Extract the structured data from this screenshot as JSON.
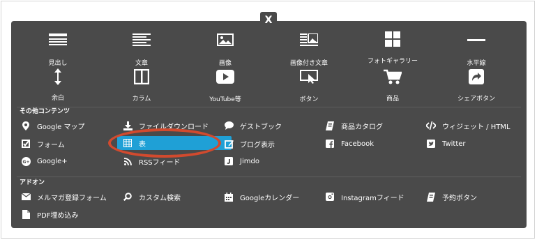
{
  "close": {
    "label": "X"
  },
  "tiles_row1": [
    {
      "label": "見出し",
      "icon": "heading-icon"
    },
    {
      "label": "文章",
      "icon": "text-icon"
    },
    {
      "label": "画像",
      "icon": "image-icon"
    },
    {
      "label": "画像付き文章",
      "icon": "image-text-icon"
    },
    {
      "label": "フォトギャラリー",
      "icon": "gallery-icon"
    },
    {
      "label": "水平線",
      "icon": "horizontal-line-icon"
    }
  ],
  "tiles_row2": [
    {
      "label": "余白",
      "icon": "spacing-icon"
    },
    {
      "label": "カラム",
      "icon": "column-icon"
    },
    {
      "label": "YouTube等",
      "icon": "video-icon"
    },
    {
      "label": "ボタン",
      "icon": "button-icon"
    },
    {
      "label": "商品",
      "icon": "cart-icon"
    },
    {
      "label": "シェアボタン",
      "icon": "share-icon"
    }
  ],
  "other": {
    "title": "その他コンテンツ",
    "items": [
      {
        "label": "Google マップ",
        "icon": "map-pin-icon"
      },
      {
        "label": "ファイルダウンロード",
        "icon": "download-icon"
      },
      {
        "label": "ゲストブック",
        "icon": "speech-bubble-icon"
      },
      {
        "label": "商品カタログ",
        "icon": "catalog-icon"
      },
      {
        "label": "ウィジェット / HTML",
        "icon": "code-icon"
      },
      {
        "label": "フォーム",
        "icon": "checkbox-icon"
      },
      {
        "label": "表",
        "icon": "table-icon"
      },
      {
        "label": "ブログ表示",
        "icon": "edit-icon"
      },
      {
        "label": "Facebook",
        "icon": "facebook-icon"
      },
      {
        "label": "Twitter",
        "icon": "twitter-icon"
      },
      {
        "label": "Google+",
        "icon": "google-plus-icon"
      },
      {
        "label": "RSSフィード",
        "icon": "rss-icon"
      },
      {
        "label": "Jimdo",
        "icon": "jimdo-icon"
      }
    ]
  },
  "addon": {
    "title": "アドオン",
    "items": [
      {
        "label": "メルマガ登録フォーム",
        "icon": "mail-icon"
      },
      {
        "label": "カスタム検索",
        "icon": "search-icon"
      },
      {
        "label": "Googleカレンダー",
        "icon": "calendar-icon"
      },
      {
        "label": "Instagramフィード",
        "icon": "instagram-icon"
      },
      {
        "label": "予約ボタン",
        "icon": "reservation-icon"
      },
      {
        "label": "PDF埋め込み",
        "icon": "pdf-icon"
      }
    ]
  },
  "colors": {
    "panel": "#4a4a4a",
    "selected": "#1fa0d6",
    "annotation": "#d24a2e"
  }
}
